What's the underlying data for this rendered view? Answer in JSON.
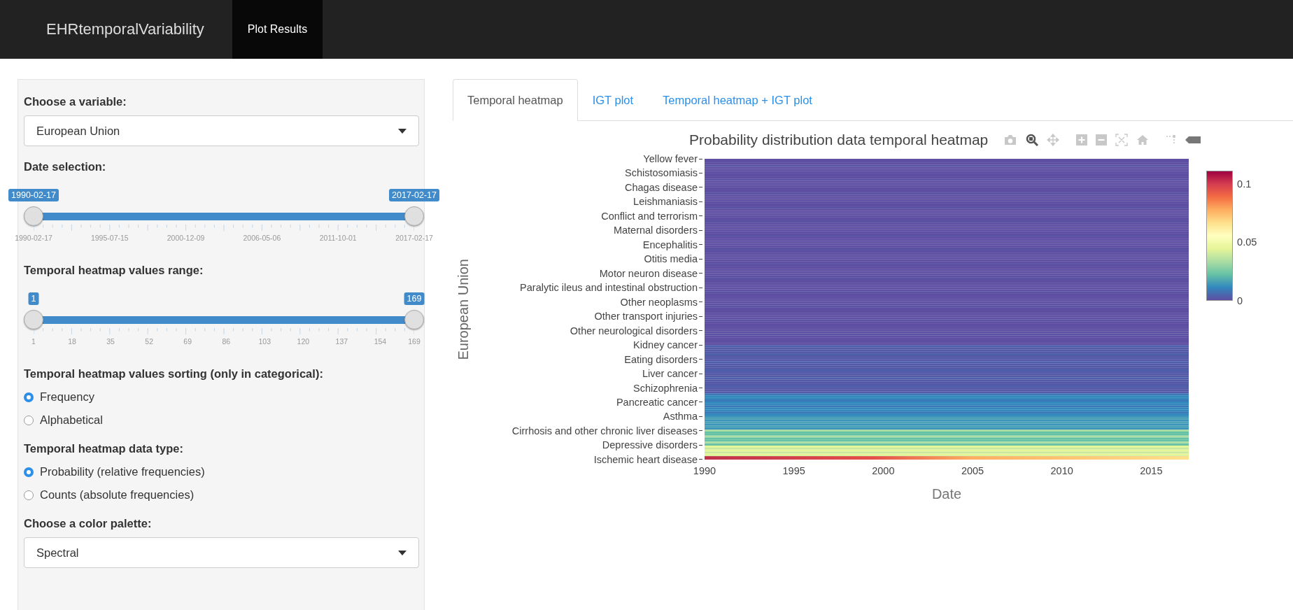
{
  "navbar": {
    "brand": "EHRtemporalVariability",
    "tabs": [
      {
        "label": "Plot Results",
        "selected": true
      }
    ]
  },
  "sidebar": {
    "variable": {
      "label": "Choose a variable:",
      "value": "European Union"
    },
    "date_slider": {
      "label": "Date selection:",
      "from": "1990-02-17",
      "to": "2017-02-17",
      "ticks": [
        "1990-02-17",
        "1995-07-15",
        "2000-12-09",
        "2006-05-06",
        "2011-10-01",
        "2017-02-17"
      ]
    },
    "range_slider": {
      "label": "Temporal heatmap values range:",
      "from": "1",
      "to": "169",
      "ticks": [
        "1",
        "18",
        "35",
        "52",
        "69",
        "86",
        "103",
        "120",
        "137",
        "154",
        "169"
      ]
    },
    "sorting": {
      "label": "Temporal heatmap values sorting (only in categorical):",
      "options": [
        {
          "label": "Frequency",
          "selected": true
        },
        {
          "label": "Alphabetical",
          "selected": false
        }
      ]
    },
    "data_type": {
      "label": "Temporal heatmap data type:",
      "options": [
        {
          "label": "Probability (relative frequencies)",
          "selected": true
        },
        {
          "label": "Counts (absolute frequencies)",
          "selected": false
        }
      ]
    },
    "palette": {
      "label": "Choose a color palette:",
      "value": "Spectral"
    }
  },
  "tabs": [
    {
      "label": "Temporal heatmap",
      "selected": true
    },
    {
      "label": "IGT plot",
      "selected": false
    },
    {
      "label": "Temporal heatmap + IGT plot",
      "selected": false
    }
  ],
  "plot": {
    "title": "Probability distribution data temporal heatmap",
    "y_title": "European Union",
    "x_title": "Date",
    "y_labels": [
      "Yellow fever",
      "Schistosomiasis",
      "Chagas disease",
      "Leishmaniasis",
      "Conflict and terrorism",
      "Maternal disorders",
      "Encephalitis",
      "Otitis media",
      "Motor neuron disease",
      "Paralytic ileus and intestinal obstruction",
      "Other neoplasms",
      "Other transport injuries",
      "Other neurological disorders",
      "Kidney cancer",
      "Eating disorders",
      "Liver cancer",
      "Schizophrenia",
      "Pancreatic cancer",
      "Asthma",
      "Cirrhosis and other chronic liver diseases",
      "Depressive disorders",
      "Ischemic heart disease"
    ],
    "x_ticks": [
      "1990",
      "1995",
      "2000",
      "2005",
      "2010",
      "2015"
    ],
    "colorbar_ticks": [
      "0.1",
      "0.05",
      "0"
    ]
  }
}
